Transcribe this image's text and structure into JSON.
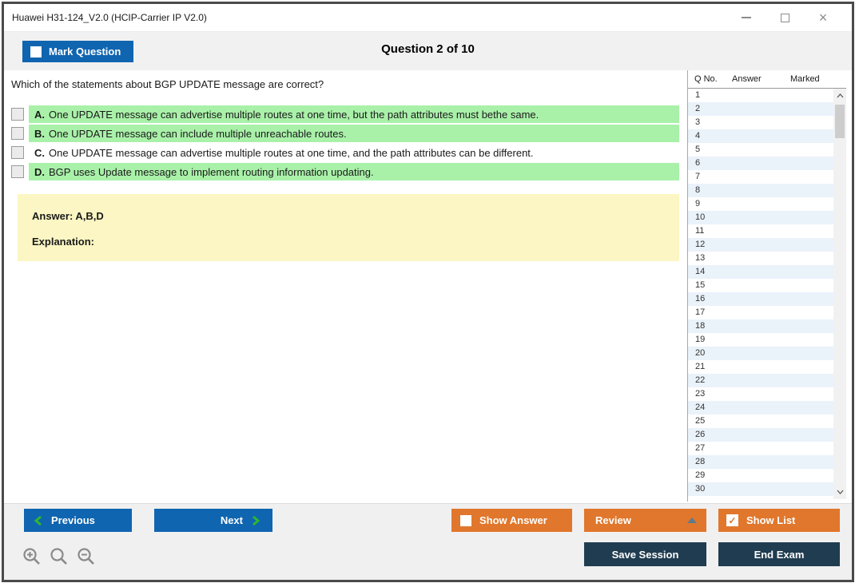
{
  "window": {
    "title": "Huawei H31-124_V2.0 (HCIP-Carrier IP V2.0)"
  },
  "header": {
    "mark_question_label": "Mark Question",
    "question_counter": "Question 2 of 10"
  },
  "question": {
    "text": "Which of the statements about BGP UPDATE message are correct?",
    "options": [
      {
        "letter": "A.",
        "text": "One UPDATE message can advertise multiple routes at one time, but the path attributes must bethe same.",
        "highlighted": true
      },
      {
        "letter": "B.",
        "text": "One UPDATE message can include multiple unreachable routes.",
        "highlighted": true
      },
      {
        "letter": "C.",
        "text": "One UPDATE message can advertise multiple routes at one time, and the path attributes can be different.",
        "highlighted": false
      },
      {
        "letter": "D.",
        "text": "BGP uses Update message to implement routing information updating.",
        "highlighted": true
      }
    ],
    "answer_label": "Answer: A,B,D",
    "explanation_label": "Explanation:"
  },
  "question_list": {
    "columns": [
      "Q No.",
      "Answer",
      "Marked"
    ],
    "rows": [
      "1",
      "2",
      "3",
      "4",
      "5",
      "6",
      "7",
      "8",
      "9",
      "10",
      "11",
      "12",
      "13",
      "14",
      "15",
      "16",
      "17",
      "18",
      "19",
      "20",
      "21",
      "22",
      "23",
      "24",
      "25",
      "26",
      "27",
      "28",
      "29",
      "30"
    ]
  },
  "footer": {
    "previous_label": "Previous",
    "next_label": "Next",
    "show_answer_label": "Show Answer",
    "review_label": "Review",
    "show_list_label": "Show List",
    "save_session_label": "Save Session",
    "end_exam_label": "End Exam",
    "show_list_check_glyph": "✓"
  },
  "icons": {
    "zoom_in": "zoom-in-icon",
    "zoom_reset": "zoom-reset-icon",
    "zoom_out": "zoom-out-icon"
  },
  "colors": {
    "accent_blue": "#1065b0",
    "accent_orange": "#e0772c",
    "dark_navy": "#203c50",
    "correct_green": "#a9f1a9",
    "answer_yellow": "#fbf6c3",
    "row_alt_blue": "#eaf2fa",
    "chevron_green": "#2eb82e",
    "frame_gray": "#4a4a4a"
  }
}
